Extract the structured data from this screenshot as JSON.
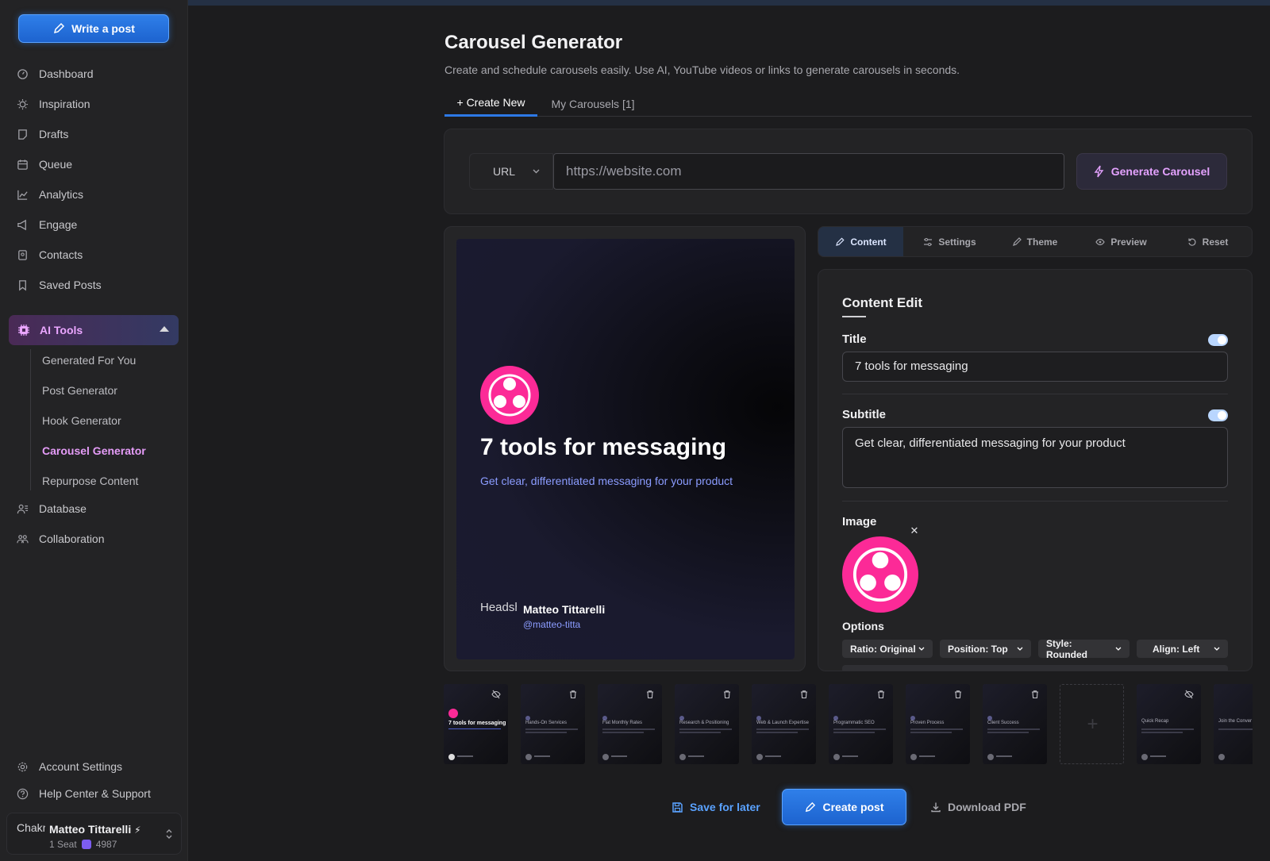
{
  "sidebar": {
    "write_post": "Write a post",
    "nav": [
      {
        "label": "Dashboard"
      },
      {
        "label": "Inspiration"
      },
      {
        "label": "Drafts"
      },
      {
        "label": "Queue"
      },
      {
        "label": "Analytics"
      },
      {
        "label": "Engage"
      },
      {
        "label": "Contacts"
      },
      {
        "label": "Saved Posts"
      }
    ],
    "ai_tools": "AI Tools",
    "ai_sub": [
      {
        "label": "Generated For You"
      },
      {
        "label": "Post Generator"
      },
      {
        "label": "Hook Generator"
      },
      {
        "label": "Carousel Generator"
      },
      {
        "label": "Repurpose Content"
      }
    ],
    "nav2": [
      {
        "label": "Database"
      },
      {
        "label": "Collaboration"
      }
    ],
    "account_settings": "Account Settings",
    "help": "Help Center & Support",
    "user": {
      "avatar_alt": "Chakra",
      "name": "Matteo Tittarelli",
      "bolt": "⚡",
      "seat": "1 Seat",
      "credits": "4987"
    }
  },
  "main": {
    "title": "Carousel Generator",
    "subtitle": "Create and schedule carousels easily. Use AI, YouTube videos or links to generate carousels in seconds.",
    "tabs": [
      {
        "label": "+ Create New"
      },
      {
        "label": "My Carousels [1]"
      }
    ],
    "source_select": "URL",
    "url_placeholder": "https://website.com",
    "generate_button": "Generate Carousel"
  },
  "slide": {
    "title": "7 tools for messaging",
    "subtitle": "Get clear, differentiated messaging for your product",
    "avatar_alt": "Headshot",
    "author": "Matteo Tittarelli",
    "handle": "@matteo-titta"
  },
  "editor": {
    "tabs": [
      {
        "label": "Content"
      },
      {
        "label": "Settings"
      },
      {
        "label": "Theme"
      },
      {
        "label": "Preview"
      },
      {
        "label": "Reset"
      }
    ],
    "heading": "Content Edit",
    "title_label": "Title",
    "title_value": "7 tools for messaging",
    "subtitle_label": "Subtitle",
    "subtitle_value": "Get clear, differentiated messaging for your product",
    "image_label": "Image",
    "options_label": "Options",
    "options": [
      {
        "label": "Ratio: Original"
      },
      {
        "label": "Position: Top"
      },
      {
        "label": "Style: Rounded"
      },
      {
        "label": "Align: Left"
      }
    ]
  },
  "thumbnails": [
    {
      "title": "7 tools for messaging",
      "icon": "eye-off-icon"
    },
    {
      "title": "Hands-On Services",
      "icon": "trash-icon"
    },
    {
      "title": "Flat Monthly Rates",
      "icon": "trash-icon"
    },
    {
      "title": "Research & Positioning",
      "icon": "trash-icon"
    },
    {
      "title": "Web & Launch Expertise",
      "icon": "trash-icon"
    },
    {
      "title": "Programmatic SEO",
      "icon": "trash-icon"
    },
    {
      "title": "Proven Process",
      "icon": "trash-icon"
    },
    {
      "title": "Client Success",
      "icon": "trash-icon"
    },
    {
      "title": "",
      "icon": "plus-icon"
    },
    {
      "title": "Quick Recap",
      "icon": "eye-off-icon"
    },
    {
      "title": "Join the Conver",
      "icon": "none"
    }
  ],
  "actions": {
    "save": "Save for later",
    "create": "Create post",
    "pdf": "Download PDF"
  },
  "colors": {
    "accent_blue": "#2d79e6",
    "accent_pink": "#fc2a97",
    "accent_purple": "#e59cf8"
  }
}
